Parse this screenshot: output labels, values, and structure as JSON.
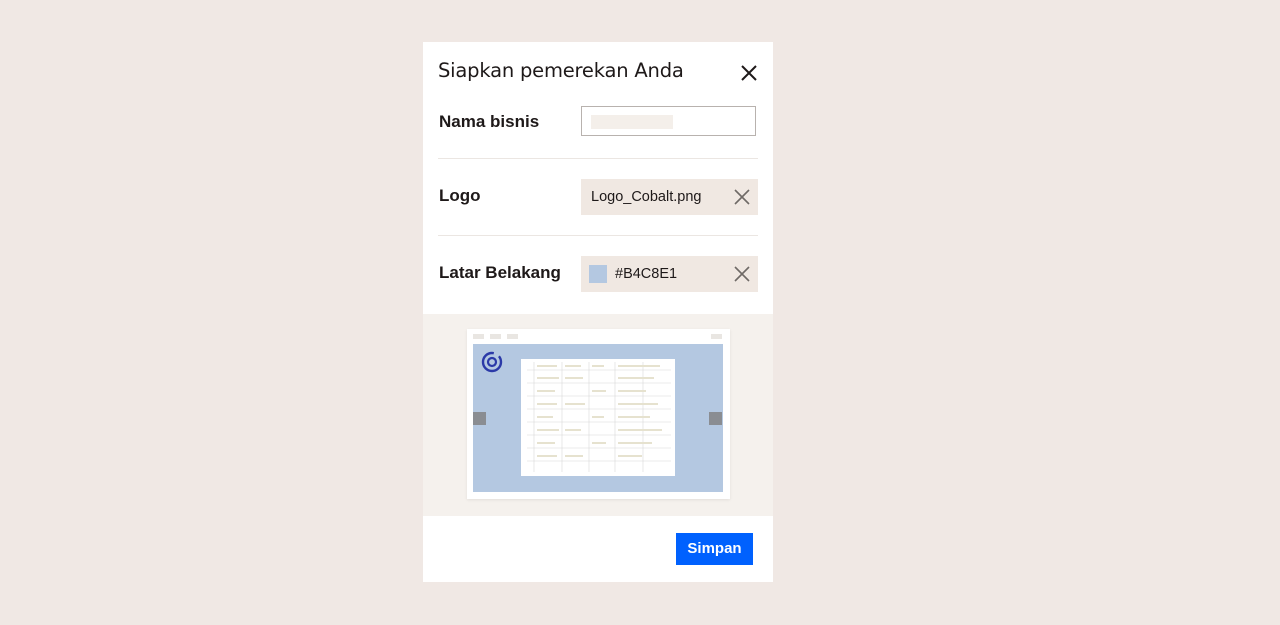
{
  "dialog": {
    "title": "Siapkan pemerekan Anda"
  },
  "form": {
    "business_name": {
      "label": "Nama bisnis",
      "value": ""
    },
    "logo": {
      "label": "Logo",
      "file_name": "Logo_Cobalt.png"
    },
    "background": {
      "label": "Latar Belakang",
      "color_value": "#B4C8E1",
      "swatch_color": "#B4C8E1"
    }
  },
  "preview": {
    "background_color": "#B4C8E1",
    "logo_color": "#2b3aa8"
  },
  "footer": {
    "save_label": "Simpan",
    "save_color": "#0061fe"
  },
  "icons": {
    "close": "close-icon",
    "clear_logo": "clear-icon",
    "clear_background": "clear-icon"
  }
}
